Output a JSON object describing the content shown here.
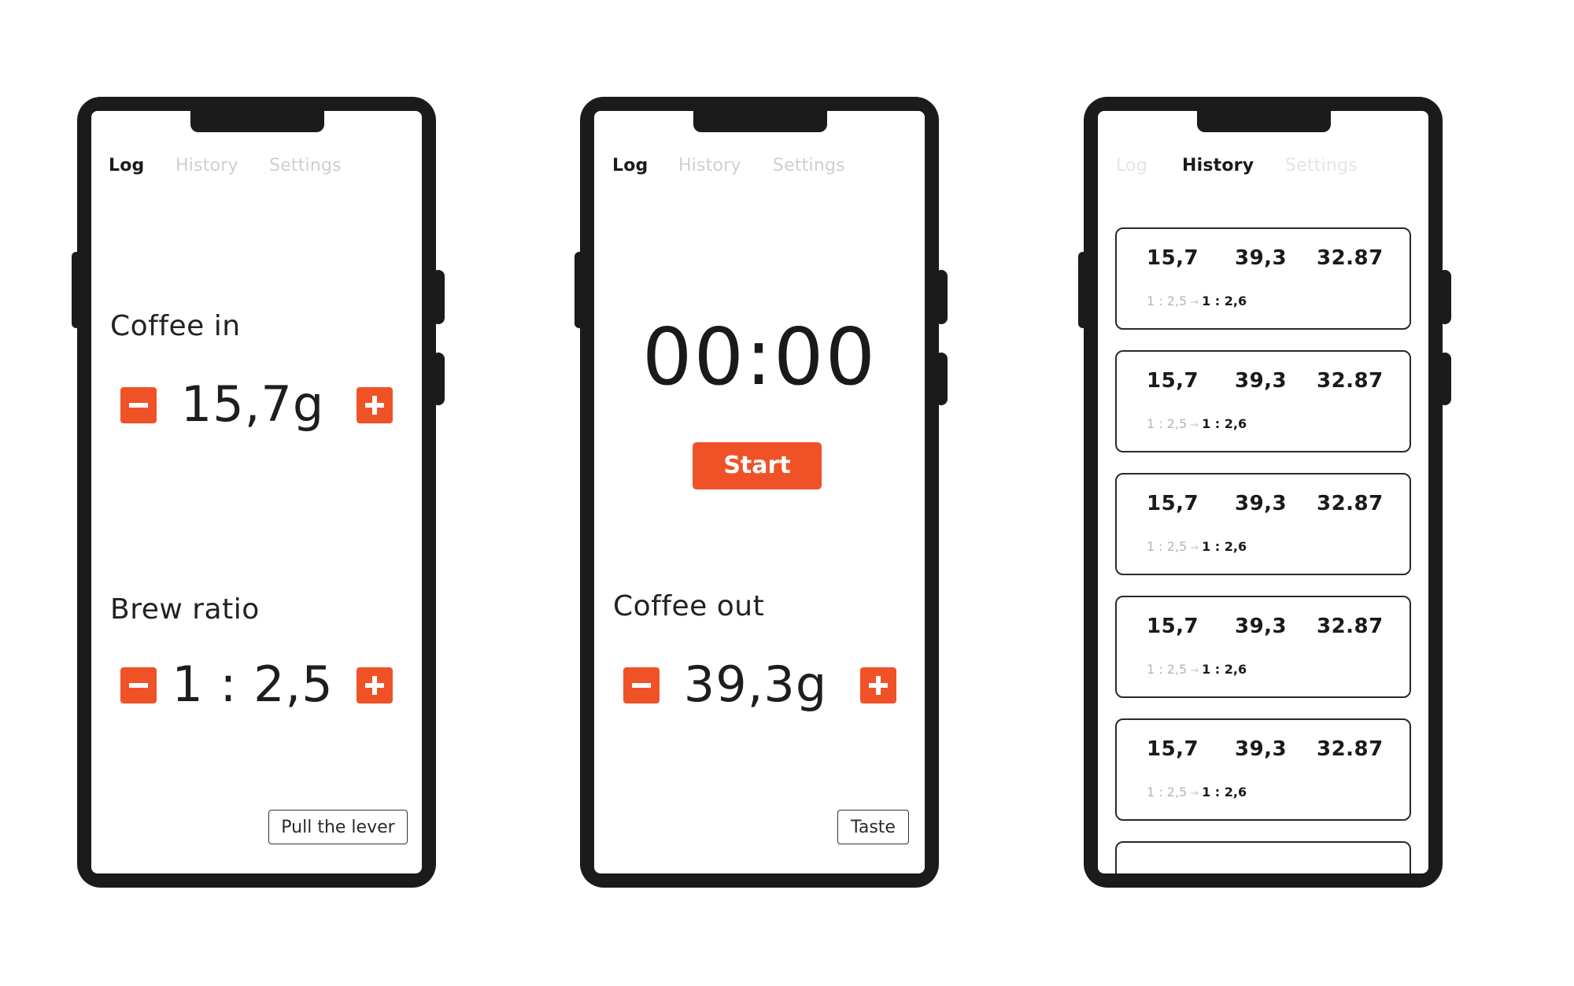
{
  "tabs": [
    "Log",
    "History",
    "Settings"
  ],
  "colors": {
    "accent": "#f05228",
    "device": "#1b1b1b",
    "tab_inactive": "#cfcfcf",
    "tab_active": "#1a1a1a"
  },
  "screens": [
    {
      "active_tab": "Log",
      "coffee_in": {
        "label": "Coffee in",
        "value": "15,7g",
        "minus_icon": "minus-icon",
        "plus_icon": "plus-icon"
      },
      "brew_ratio": {
        "label": "Brew ratio",
        "value": "1 : 2,5",
        "minus_icon": "minus-icon",
        "plus_icon": "plus-icon"
      },
      "action_button": "Pull the lever"
    },
    {
      "active_tab": "Log",
      "timer": "00:00",
      "start_button": "Start",
      "coffee_out": {
        "label": "Coffee out",
        "value": "39,3g",
        "minus_icon": "minus-icon",
        "plus_icon": "plus-icon"
      },
      "action_button": "Taste"
    },
    {
      "active_tab": "History",
      "history": [
        {
          "coffee_in": "15,7",
          "coffee_out": "39,3",
          "time": "32.87",
          "ratio_from": "1 : 2,5",
          "arrow": "→",
          "ratio_to": "1 : 2,6"
        },
        {
          "coffee_in": "15,7",
          "coffee_out": "39,3",
          "time": "32.87",
          "ratio_from": "1 : 2,5",
          "arrow": "→",
          "ratio_to": "1 : 2,6"
        },
        {
          "coffee_in": "15,7",
          "coffee_out": "39,3",
          "time": "32.87",
          "ratio_from": "1 : 2,5",
          "arrow": "→",
          "ratio_to": "1 : 2,6"
        },
        {
          "coffee_in": "15,7",
          "coffee_out": "39,3",
          "time": "32.87",
          "ratio_from": "1 : 2,5",
          "arrow": "→",
          "ratio_to": "1 : 2,6"
        },
        {
          "coffee_in": "15,7",
          "coffee_out": "39,3",
          "time": "32.87",
          "ratio_from": "1 : 2,5",
          "arrow": "→",
          "ratio_to": "1 : 2,6"
        }
      ]
    }
  ]
}
